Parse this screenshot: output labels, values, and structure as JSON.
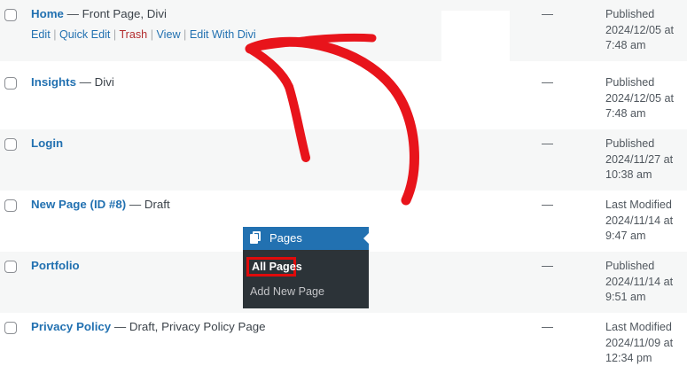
{
  "rows": [
    {
      "title": "Home",
      "state": " — Front Page, Divi",
      "dash": "—",
      "status": "Published",
      "date": "2024/12/05 at",
      "time": "7:48 am",
      "actions": {
        "edit": "Edit",
        "quick_edit": "Quick Edit",
        "trash": "Trash",
        "view": "View",
        "edit_with": "Edit With Divi",
        "sep": "|"
      }
    },
    {
      "title": "Insights",
      "state": " — Divi",
      "dash": "—",
      "status": "Published",
      "date": "2024/12/05 at",
      "time": "7:48 am"
    },
    {
      "title": "Login",
      "state": "",
      "dash": "—",
      "status": "Published",
      "date": "2024/11/27 at",
      "time": "10:38 am"
    },
    {
      "title": "New Page (ID #8)",
      "state": " — Draft",
      "dash": "—",
      "status": "Last Modified",
      "date": "2024/11/14 at",
      "time": "9:47 am"
    },
    {
      "title": "Portfolio",
      "state": "",
      "dash": "—",
      "status": "Published",
      "date": "2024/11/14 at",
      "time": "9:51 am"
    },
    {
      "title": "Privacy Policy",
      "state": " — Draft, Privacy Policy Page",
      "dash": "—",
      "status": "Last Modified",
      "date": "2024/11/09 at",
      "time": "12:34 pm"
    }
  ],
  "menu": {
    "icon": "pages-icon",
    "title": "Pages",
    "all_pages": "All Pages",
    "add_new": "Add New Page"
  },
  "colors": {
    "link": "#2271b1",
    "trash": "#b32d2e",
    "menu_active": "#2271b1",
    "menu_sub_bg": "#2c3338",
    "highlight": "#e00b0b"
  }
}
